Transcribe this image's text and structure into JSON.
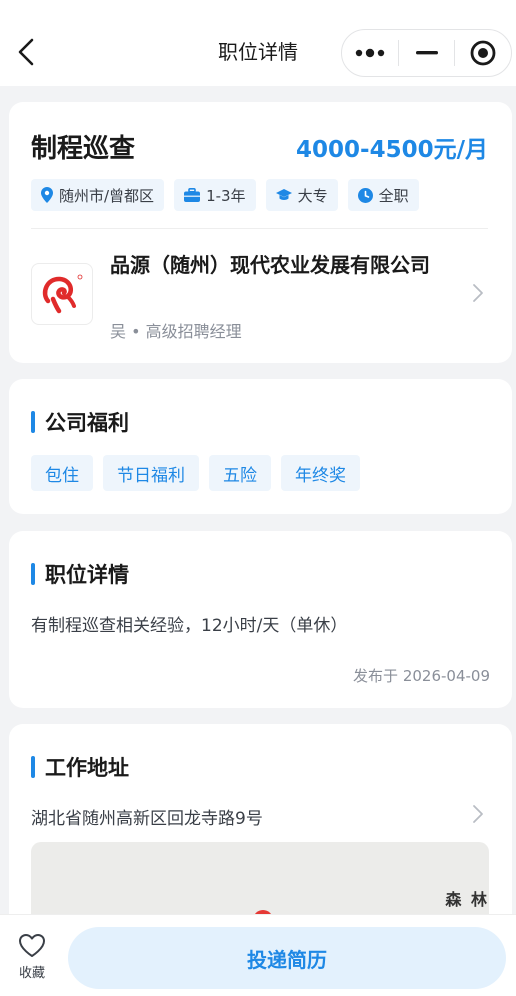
{
  "nav": {
    "title": "职位详情"
  },
  "job": {
    "title": "制程巡查",
    "salary": "4000-4500元/月",
    "tags": {
      "location": "随州市/曾都区",
      "experience": "1-3年",
      "education": "大专",
      "type": "全职"
    }
  },
  "company": {
    "name": "品源（随州）现代农业发展有限公司",
    "recruiter": "吴 • 高级招聘经理"
  },
  "benefits": {
    "title": "公司福利",
    "items": [
      "包住",
      "节日福利",
      "五险",
      "年终奖"
    ]
  },
  "details": {
    "title": "职位详情",
    "description": "有制程巡查相关经验，12小时/天（单休）",
    "publish": "发布于 2026-04-09"
  },
  "address": {
    "title": "工作地址",
    "text": "湖北省随州高新区回龙寺路9号",
    "map_label": "森 林"
  },
  "bottom": {
    "favorite": "收藏",
    "apply": "投递简历"
  },
  "colors": {
    "accent": "#1e88e5",
    "tag_bg": "#eef5fc",
    "page_bg": "#f2f3f5",
    "logo_red": "#e02b2b"
  }
}
